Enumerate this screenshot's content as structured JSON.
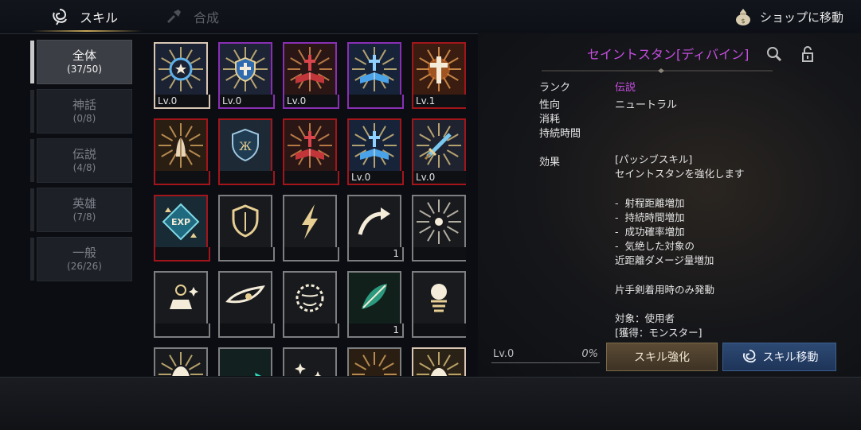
{
  "tabs": {
    "skill": "スキル",
    "synth": "合成"
  },
  "shop": {
    "label": "ショップに移動"
  },
  "categories": [
    {
      "name": "全体",
      "count": "(37/50)",
      "active": true
    },
    {
      "name": "神話",
      "count": "(0/8)",
      "active": false
    },
    {
      "name": "伝説",
      "count": "(4/8)",
      "active": false
    },
    {
      "name": "英雄",
      "count": "(7/8)",
      "active": false
    },
    {
      "name": "一般",
      "count": "(26/26)",
      "active": false
    }
  ],
  "skills": [
    {
      "icon": "holy-sun-stun-icon",
      "frame": "white",
      "level": "Lv.0",
      "count": ""
    },
    {
      "icon": "holy-shield-cross-icon",
      "frame": "purple",
      "level": "Lv.0",
      "count": ""
    },
    {
      "icon": "red-holy-book-icon",
      "frame": "purple",
      "level": "Lv.0",
      "count": ""
    },
    {
      "icon": "blue-holy-book-icon",
      "frame": "purple",
      "level": "",
      "count": ""
    },
    {
      "icon": "radiant-cross-icon",
      "frame": "red",
      "level": "Lv.1",
      "count": ""
    },
    {
      "icon": "praying-hands-icon",
      "frame": "red",
      "level": "",
      "count": ""
    },
    {
      "icon": "crest-shield-icon",
      "frame": "red",
      "level": "",
      "count": ""
    },
    {
      "icon": "red-holy-book-icon",
      "frame": "red",
      "level": "",
      "count": ""
    },
    {
      "icon": "blue-holy-book-icon",
      "frame": "red",
      "level": "Lv.0",
      "count": ""
    },
    {
      "icon": "holy-sword-icon",
      "frame": "red",
      "level": "Lv.0",
      "count": ""
    },
    {
      "icon": "exp-boost-icon",
      "frame": "red",
      "level": "",
      "count": ""
    },
    {
      "icon": "guard-shield-icon",
      "frame": "gray",
      "level": "",
      "count": ""
    },
    {
      "icon": "lightning-icon",
      "frame": "gray",
      "level": "",
      "count": ""
    },
    {
      "icon": "curved-arrow-icon",
      "frame": "gray",
      "level": "",
      "count": "1"
    },
    {
      "icon": "shatter-burst-icon",
      "frame": "gray",
      "level": "",
      "count": ""
    },
    {
      "icon": "sparkle-anvil-icon",
      "frame": "gray",
      "level": "",
      "count": ""
    },
    {
      "icon": "eagle-eye-icon",
      "frame": "gray",
      "level": "",
      "count": ""
    },
    {
      "icon": "fury-face-icon",
      "frame": "gray",
      "level": "",
      "count": ""
    },
    {
      "icon": "leaf-strike-icon",
      "frame": "gray",
      "level": "",
      "count": "1"
    },
    {
      "icon": "glowing-orb-icon",
      "frame": "gray",
      "level": "",
      "count": ""
    },
    {
      "icon": "helmet-icon",
      "frame": "gray",
      "level": "",
      "count": ""
    },
    {
      "icon": "teal-swirl-icon",
      "frame": "gray",
      "level": "",
      "count": ""
    },
    {
      "icon": "sparkles-icon",
      "frame": "gray",
      "level": "",
      "count": ""
    },
    {
      "icon": "radiant-wave-icon",
      "frame": "gray",
      "level": "",
      "count": ""
    },
    {
      "icon": "radiant-helmet-icon",
      "frame": "white",
      "level": "",
      "count": ""
    }
  ],
  "detail": {
    "title": "セイントスタン[ディバイン]",
    "rank_label": "ランク",
    "rank_value": "伝説",
    "trait_label": "性向",
    "trait_value": "ニュートラル",
    "cost_label": "消耗",
    "duration_label": "持続時間",
    "effect_label": "効果",
    "effect_text": "[パッシブスキル]\nセイントスタンを強化します\n\n-  射程距離増加\n-  持続時間増加\n-  成功確率増加\n-  気絶した対象の\n近距離ダメージ量増加\n\n片手剣着用時のみ発動\n\n対象：使用者\n[獲得：モンスター]"
  },
  "progress": {
    "level": "Lv.0",
    "percent": "0%"
  },
  "buttons": {
    "enhance": "スキル強化",
    "move": "スキル移動"
  },
  "colors": {
    "legend_purple": "#c54ee0",
    "frame_red": "#a3151b",
    "frame_purple": "#8a2fb5",
    "gold": "#c8a85a"
  }
}
